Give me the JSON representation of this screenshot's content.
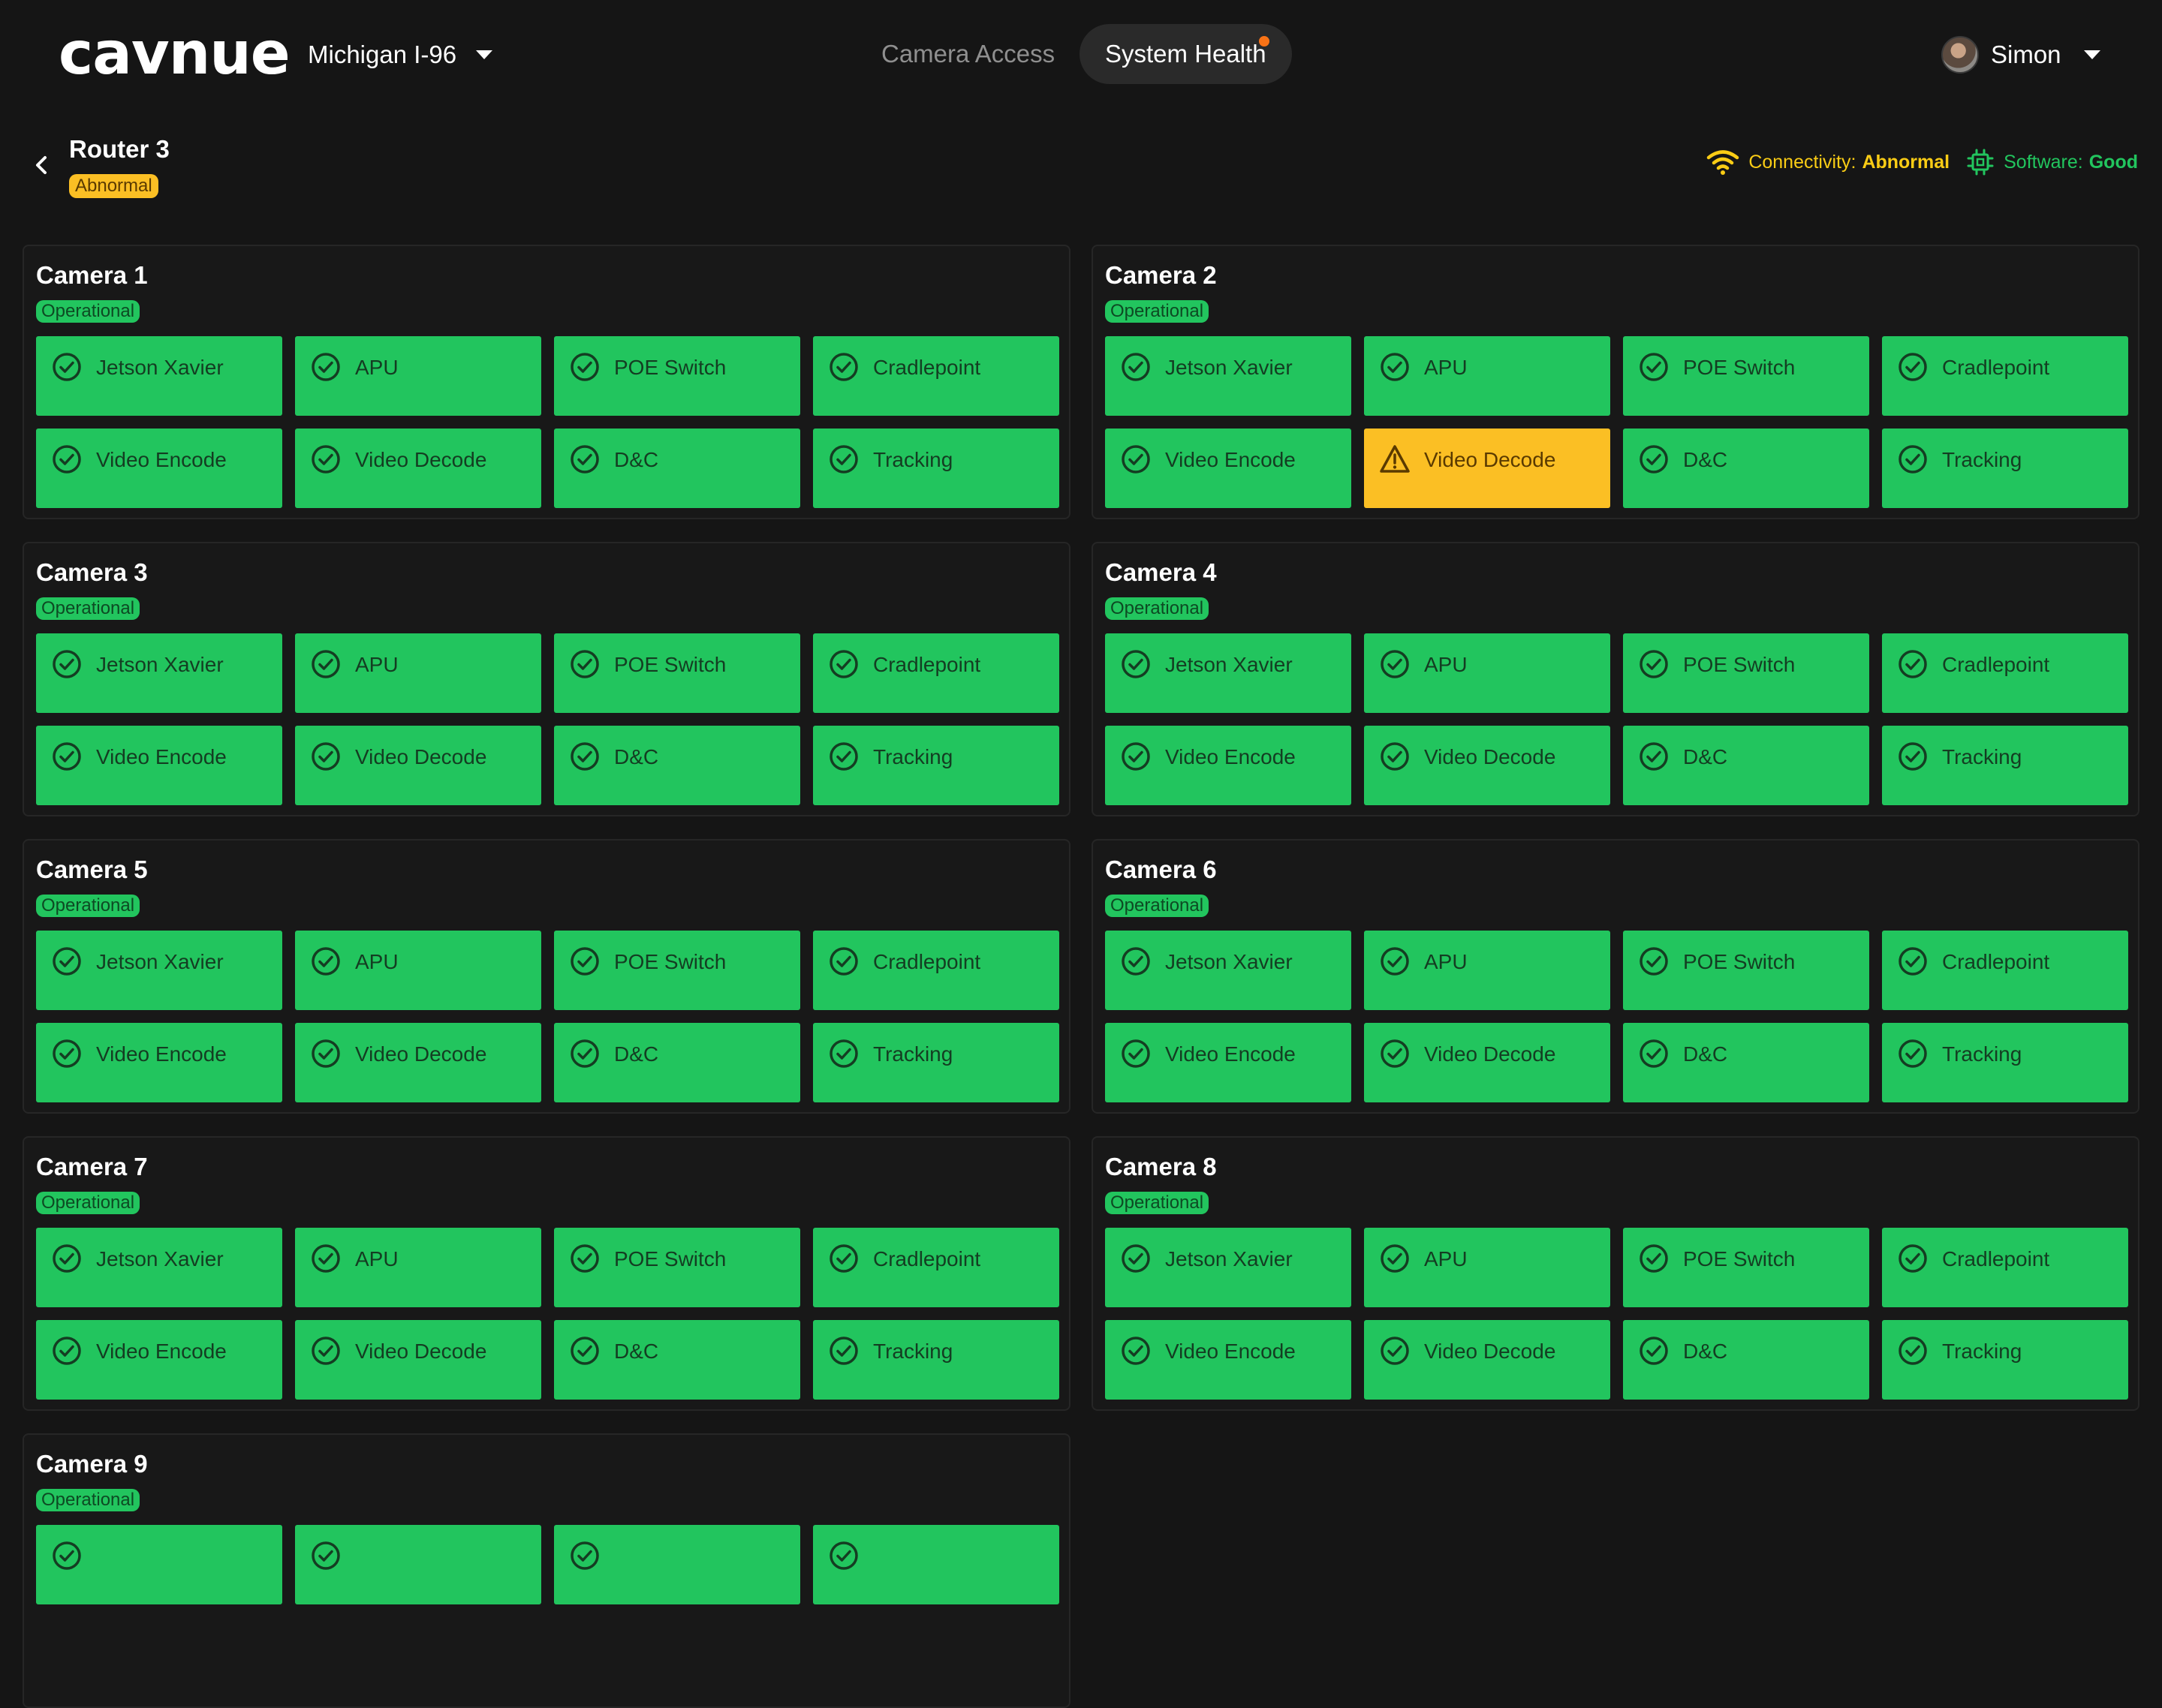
{
  "app": {
    "logo": "cavnue",
    "site_selector": {
      "value": "Michigan I-96"
    },
    "nav": [
      {
        "label": "Camera Access",
        "active": false
      },
      {
        "label": "System Health",
        "active": true,
        "has_notification": true
      }
    ],
    "user": {
      "name": "Simon"
    }
  },
  "router": {
    "title": "Router 3",
    "status": "Abnormal"
  },
  "health": {
    "connectivity": {
      "label": "Connectivity:",
      "value": "Abnormal",
      "icon": "wifi-icon",
      "color": "#facc15"
    },
    "software": {
      "label": "Software:",
      "value": "Good",
      "icon": "chip-icon",
      "color": "#22c55e"
    }
  },
  "colors": {
    "ok": "#22c55e",
    "warning": "#fbbf24",
    "background": "#151515",
    "notification": "#f97316"
  },
  "cameras": [
    {
      "name": "Camera 1",
      "status": "Operational",
      "components": [
        {
          "label": "Jetson Xavier",
          "state": "ok"
        },
        {
          "label": "APU",
          "state": "ok"
        },
        {
          "label": "POE Switch",
          "state": "ok"
        },
        {
          "label": "Cradlepoint",
          "state": "ok"
        },
        {
          "label": "Video Encode",
          "state": "ok"
        },
        {
          "label": "Video Decode",
          "state": "ok"
        },
        {
          "label": "D&C",
          "state": "ok"
        },
        {
          "label": "Tracking",
          "state": "ok"
        }
      ]
    },
    {
      "name": "Camera 2",
      "status": "Operational",
      "components": [
        {
          "label": "Jetson Xavier",
          "state": "ok"
        },
        {
          "label": "APU",
          "state": "ok"
        },
        {
          "label": "POE Switch",
          "state": "ok"
        },
        {
          "label": "Cradlepoint",
          "state": "ok"
        },
        {
          "label": "Video Encode",
          "state": "ok"
        },
        {
          "label": "Video Decode",
          "state": "warning"
        },
        {
          "label": "D&C",
          "state": "ok"
        },
        {
          "label": "Tracking",
          "state": "ok"
        }
      ]
    },
    {
      "name": "Camera 3",
      "status": "Operational",
      "components": [
        {
          "label": "Jetson Xavier",
          "state": "ok"
        },
        {
          "label": "APU",
          "state": "ok"
        },
        {
          "label": "POE Switch",
          "state": "ok"
        },
        {
          "label": "Cradlepoint",
          "state": "ok"
        },
        {
          "label": "Video Encode",
          "state": "ok"
        },
        {
          "label": "Video Decode",
          "state": "ok"
        },
        {
          "label": "D&C",
          "state": "ok"
        },
        {
          "label": "Tracking",
          "state": "ok"
        }
      ]
    },
    {
      "name": "Camera 4",
      "status": "Operational",
      "components": [
        {
          "label": "Jetson Xavier",
          "state": "ok"
        },
        {
          "label": "APU",
          "state": "ok"
        },
        {
          "label": "POE Switch",
          "state": "ok"
        },
        {
          "label": "Cradlepoint",
          "state": "ok"
        },
        {
          "label": "Video Encode",
          "state": "ok"
        },
        {
          "label": "Video Decode",
          "state": "ok"
        },
        {
          "label": "D&C",
          "state": "ok"
        },
        {
          "label": "Tracking",
          "state": "ok"
        }
      ]
    },
    {
      "name": "Camera 5",
      "status": "Operational",
      "components": [
        {
          "label": "Jetson Xavier",
          "state": "ok"
        },
        {
          "label": "APU",
          "state": "ok"
        },
        {
          "label": "POE Switch",
          "state": "ok"
        },
        {
          "label": "Cradlepoint",
          "state": "ok"
        },
        {
          "label": "Video Encode",
          "state": "ok"
        },
        {
          "label": "Video Decode",
          "state": "ok"
        },
        {
          "label": "D&C",
          "state": "ok"
        },
        {
          "label": "Tracking",
          "state": "ok"
        }
      ]
    },
    {
      "name": "Camera 6",
      "status": "Operational",
      "components": [
        {
          "label": "Jetson Xavier",
          "state": "ok"
        },
        {
          "label": "APU",
          "state": "ok"
        },
        {
          "label": "POE Switch",
          "state": "ok"
        },
        {
          "label": "Cradlepoint",
          "state": "ok"
        },
        {
          "label": "Video Encode",
          "state": "ok"
        },
        {
          "label": "Video Decode",
          "state": "ok"
        },
        {
          "label": "D&C",
          "state": "ok"
        },
        {
          "label": "Tracking",
          "state": "ok"
        }
      ]
    },
    {
      "name": "Camera 7",
      "status": "Operational",
      "components": [
        {
          "label": "Jetson Xavier",
          "state": "ok"
        },
        {
          "label": "APU",
          "state": "ok"
        },
        {
          "label": "POE Switch",
          "state": "ok"
        },
        {
          "label": "Cradlepoint",
          "state": "ok"
        },
        {
          "label": "Video Encode",
          "state": "ok"
        },
        {
          "label": "Video Decode",
          "state": "ok"
        },
        {
          "label": "D&C",
          "state": "ok"
        },
        {
          "label": "Tracking",
          "state": "ok"
        }
      ]
    },
    {
      "name": "Camera 8",
      "status": "Operational",
      "components": [
        {
          "label": "Jetson Xavier",
          "state": "ok"
        },
        {
          "label": "APU",
          "state": "ok"
        },
        {
          "label": "POE Switch",
          "state": "ok"
        },
        {
          "label": "Cradlepoint",
          "state": "ok"
        },
        {
          "label": "Video Encode",
          "state": "ok"
        },
        {
          "label": "Video Decode",
          "state": "ok"
        },
        {
          "label": "D&C",
          "state": "ok"
        },
        {
          "label": "Tracking",
          "state": "ok"
        }
      ]
    },
    {
      "name": "Camera 9",
      "status": "Operational",
      "components": [
        {
          "label": "",
          "state": "ok"
        },
        {
          "label": "",
          "state": "ok"
        },
        {
          "label": "",
          "state": "ok"
        },
        {
          "label": "",
          "state": "ok"
        }
      ]
    }
  ]
}
